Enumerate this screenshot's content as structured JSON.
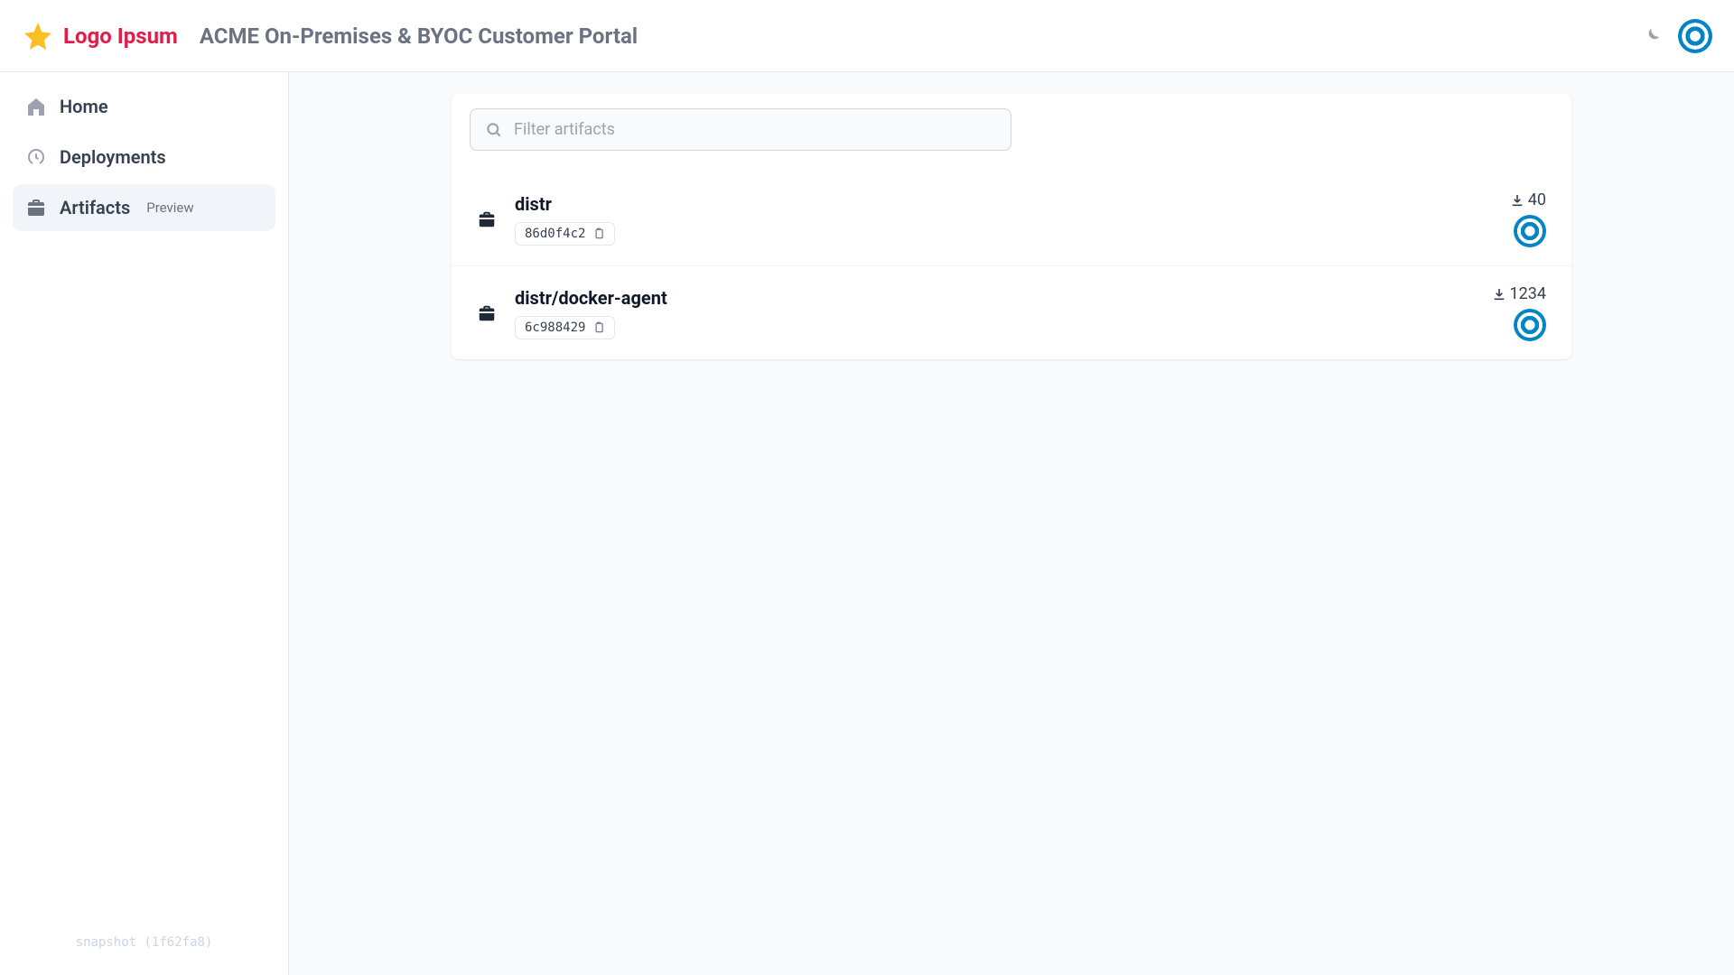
{
  "header": {
    "logo_text": "Logo Ipsum",
    "title": "ACME On-Premises & BYOC Customer Portal"
  },
  "sidebar": {
    "items": [
      {
        "label": "Home",
        "active": false,
        "icon": "home"
      },
      {
        "label": "Deployments",
        "active": false,
        "icon": "gauge"
      },
      {
        "label": "Artifacts",
        "active": true,
        "icon": "briefcase",
        "badge": "Preview"
      }
    ],
    "snapshot": "snapshot (1f62fa8)"
  },
  "main": {
    "search_placeholder": "Filter artifacts",
    "artifacts": [
      {
        "name": "distr",
        "hash": "86d0f4c2",
        "downloads": "40"
      },
      {
        "name": "distr/docker-agent",
        "hash": "6c988429",
        "downloads": "1234"
      }
    ]
  }
}
